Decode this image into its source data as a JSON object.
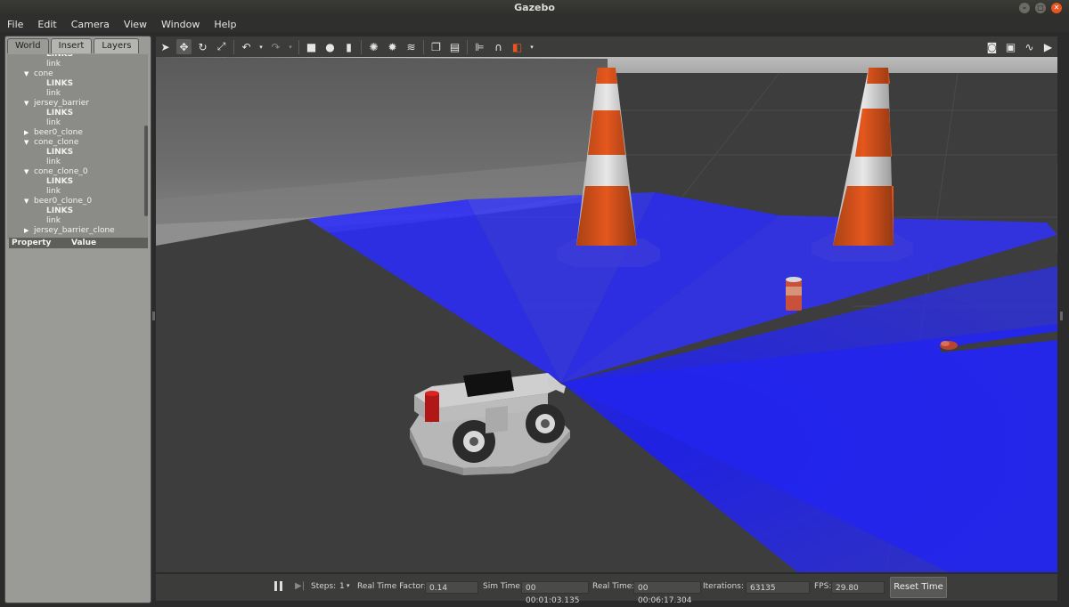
{
  "window": {
    "title": "Gazebo"
  },
  "menu": [
    "File",
    "Edit",
    "Camera",
    "View",
    "Window",
    "Help"
  ],
  "left_panel": {
    "tabs": [
      "World",
      "Insert",
      "Layers"
    ],
    "tree": [
      {
        "text": "LINKS",
        "level": 2,
        "bold": true
      },
      {
        "text": "link",
        "level": 2
      },
      {
        "text": "cone",
        "level": 1,
        "expanded": true
      },
      {
        "text": "LINKS",
        "level": 2,
        "bold": true
      },
      {
        "text": "link",
        "level": 2
      },
      {
        "text": "jersey_barrier",
        "level": 1,
        "expanded": true
      },
      {
        "text": "LINKS",
        "level": 2,
        "bold": true
      },
      {
        "text": "link",
        "level": 2
      },
      {
        "text": "beer0_clone",
        "level": 1,
        "expanded": false
      },
      {
        "text": "cone_clone",
        "level": 1,
        "expanded": true
      },
      {
        "text": "LINKS",
        "level": 2,
        "bold": true
      },
      {
        "text": "link",
        "level": 2
      },
      {
        "text": "cone_clone_0",
        "level": 1,
        "expanded": true
      },
      {
        "text": "LINKS",
        "level": 2,
        "bold": true
      },
      {
        "text": "link",
        "level": 2
      },
      {
        "text": "beer0_clone_0",
        "level": 1,
        "expanded": true
      },
      {
        "text": "LINKS",
        "level": 2,
        "bold": true
      },
      {
        "text": "link",
        "level": 2
      },
      {
        "text": "jersey_barrier_clone",
        "level": 1,
        "expanded": false
      }
    ],
    "property_header": {
      "property": "Property",
      "value": "Value"
    }
  },
  "bottom": {
    "steps_label": "Steps:",
    "steps_value": "1",
    "rtf_label": "Real Time Factor:",
    "rtf_value": "0.14",
    "sim_time_label": "Sim Time:",
    "sim_time_value": "00 00:01:03.135",
    "real_time_label": "Real Time:",
    "real_time_value": "00 00:06:17.304",
    "iterations_label": "Iterations:",
    "iterations_value": "63135",
    "fps_label": "FPS:",
    "fps_value": "29.80",
    "reset_label": "Reset Time"
  },
  "colors": {
    "laser": "#2a2cff",
    "ground": "#3d3d3d",
    "accent": "#e95420"
  }
}
